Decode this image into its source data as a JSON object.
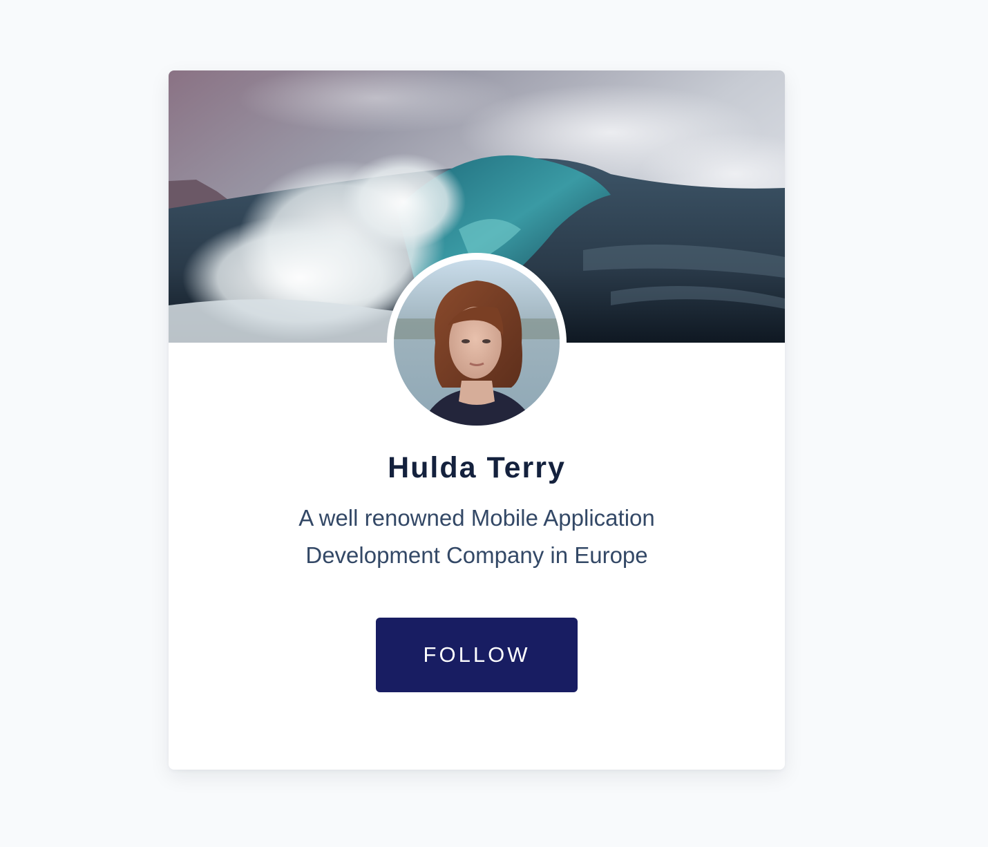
{
  "profile_card": {
    "name": "Hulda Terry",
    "bio_line_1": "A well renowned Mobile Application",
    "bio_line_2": "Development Company in Europe",
    "follow_label": "FOLLOW"
  },
  "colors": {
    "page_background": "#f8fafc",
    "card_background": "#ffffff",
    "name_text": "#14213d",
    "bio_text": "#334866",
    "button_background": "#181d62",
    "button_text": "#ffffff"
  },
  "images": {
    "cover": "ocean-wave-photo",
    "avatar": "woman-portrait-photo"
  }
}
